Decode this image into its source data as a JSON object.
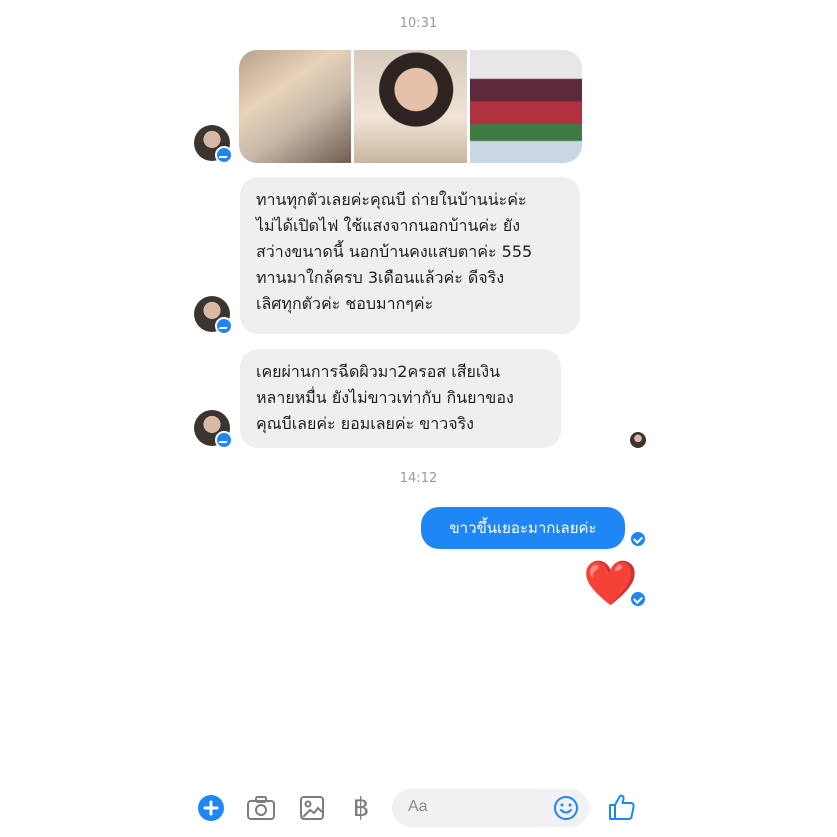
{
  "thread": {
    "timestamp_1": "10:31",
    "timestamp_2": "14:12",
    "messages_in": [
      "ทานทุกตัวเลยค่ะคุณบี ถ่ายในบ้านน่ะค่ะ\nไม่ได้เปิดไฟ ใช้แสงจากนอกบ้านค่ะ ยัง\nสว่างขนาดนี้ นอกบ้านคงแสบตาค่ะ 555\nทานมาใกล้ครบ 3เดือนแล้วค่ะ ดีจริง\nเลิศทุกตัวค่ะ ชอบมากๆค่ะ",
      "เคยผ่านการฉีดผิวมา2ครอส เสียเงิน\nหลายหมื่น ยังไม่ขาวเท่ากับ กินยาของ\nคุณบีเลยค่ะ ยอมเลยค่ะ ขาวจริง"
    ],
    "message_out": "ขาวขึ้นเยอะมากเลยค่ะ",
    "heart_emoji": "❤️"
  },
  "composer": {
    "placeholder": "Aa",
    "icons": [
      "plus-icon",
      "camera-icon",
      "image-icon",
      "baht-icon",
      "emoji-icon",
      "like-icon"
    ]
  },
  "colors": {
    "accent": "#1f86f5",
    "incoming_bubble": "#efefef",
    "timestamp": "#9a9a9a"
  }
}
